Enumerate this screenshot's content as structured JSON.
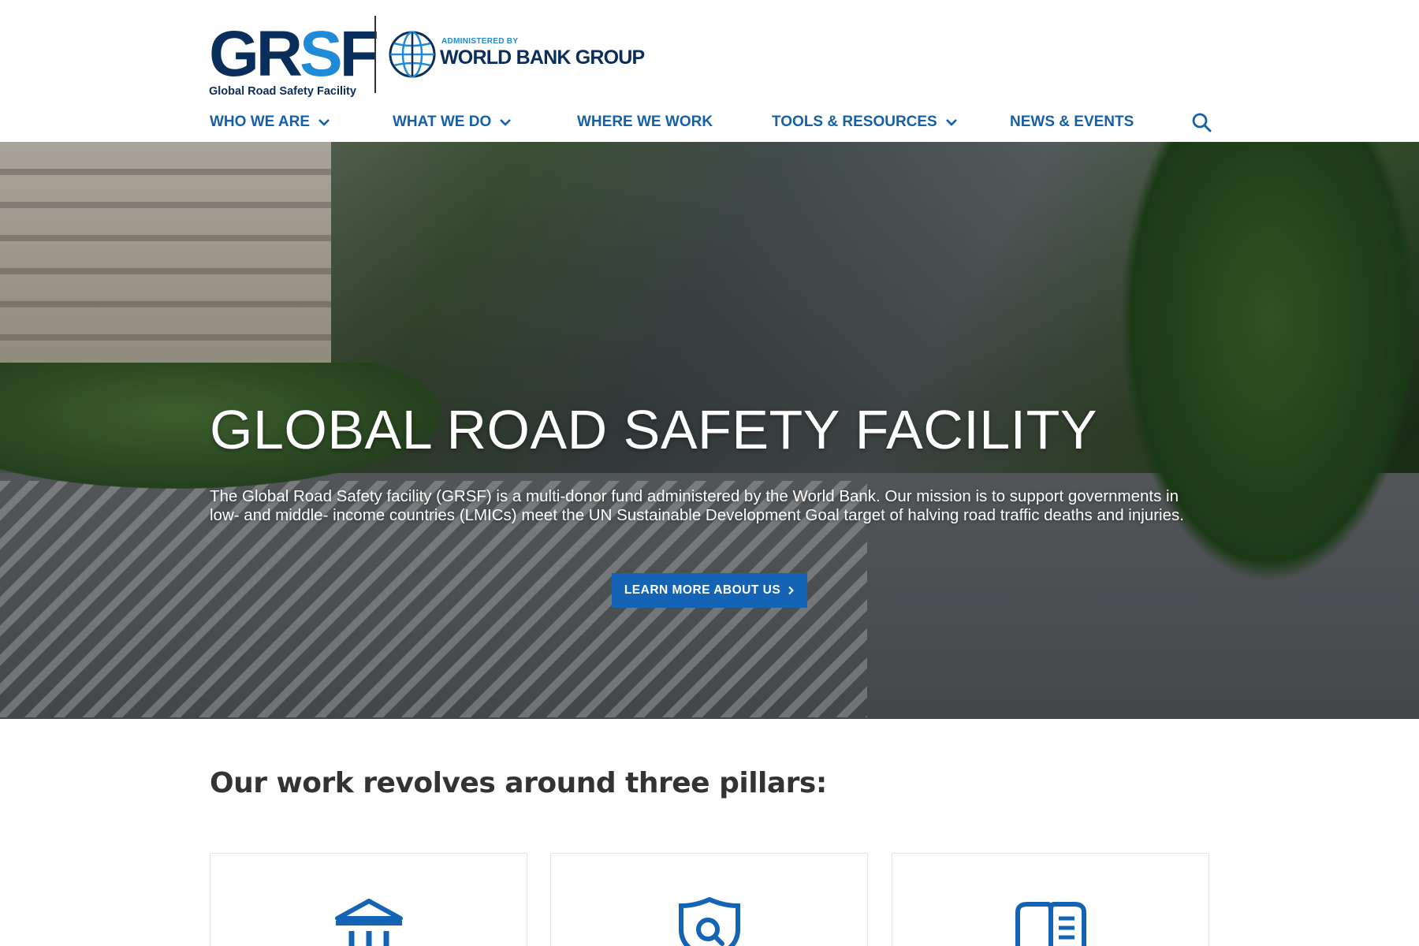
{
  "brand": {
    "grsf_letters_a": "GR",
    "grsf_letters_b": "S",
    "grsf_letters_c": "F",
    "grsf_tagline": "Global Road Safety Facility",
    "administered_by": "ADMINISTERED BY",
    "wbg_name": "WORLD BANK GROUP",
    "colors": {
      "navy": "#0a2e5c",
      "blue": "#1560a8",
      "button": "#1463b5",
      "accent": "#1f8bd6"
    }
  },
  "nav": {
    "items": [
      {
        "label": "WHO WE ARE",
        "dropdown": true
      },
      {
        "label": "WHAT WE DO",
        "dropdown": true
      },
      {
        "label": "WHERE WE WORK",
        "dropdown": false
      },
      {
        "label": "TOOLS & RESOURCES",
        "dropdown": true
      },
      {
        "label": "NEWS & EVENTS",
        "dropdown": false
      }
    ],
    "search_icon": "search-icon"
  },
  "hero": {
    "title": "GLOBAL ROAD SAFETY FACILITY",
    "text": "The Global Road Safety facility (GRSF) is a multi-donor fund administered by the World Bank. Our mission is to support governments in low- and middle- income countries (LMICs) meet the UN Sustainable Development Goal target of halving road traffic deaths and injuries.",
    "button_label": "LEARN MORE ABOUT US"
  },
  "pillars": {
    "heading": "Our work revolves around three pillars:",
    "cards": [
      {
        "icon": "institution-icon"
      },
      {
        "icon": "shield-search-icon"
      },
      {
        "icon": "open-book-icon"
      }
    ]
  }
}
